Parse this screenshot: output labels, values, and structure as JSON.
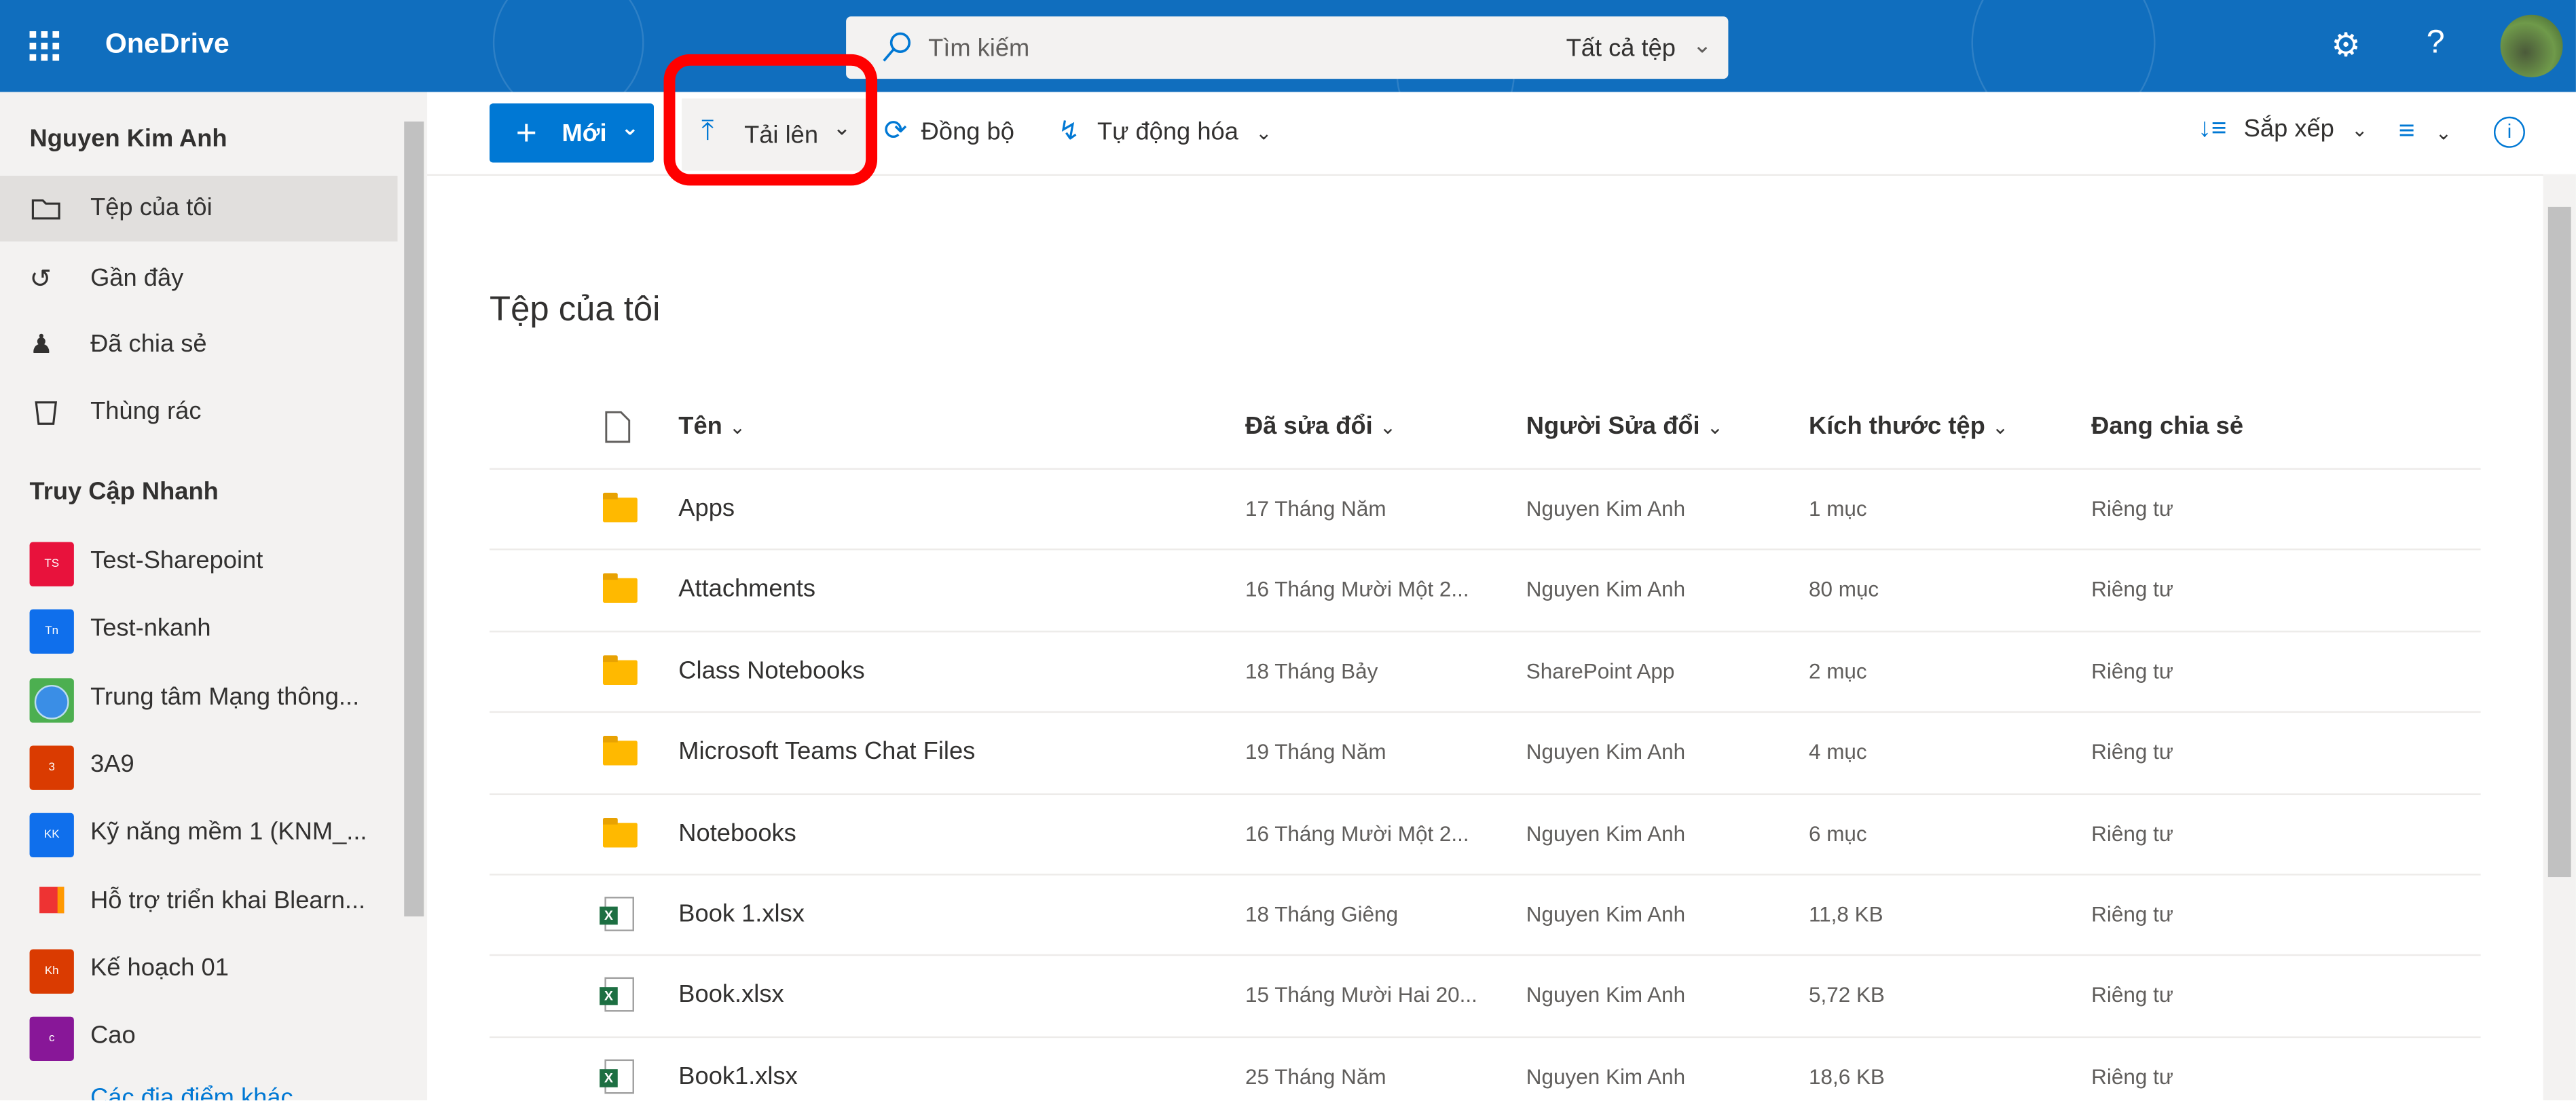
{
  "header": {
    "app_name": "OneDrive",
    "search_placeholder": "Tìm kiếm",
    "search_scope": "Tất cả tệp"
  },
  "sidebar": {
    "user": "Nguyen Kim Anh",
    "nav": [
      {
        "label": "Tệp của tôi",
        "icon": "folder-icon",
        "selected": true
      },
      {
        "label": "Gần đây",
        "icon": "history-icon"
      },
      {
        "label": "Đã chia sẻ",
        "icon": "people-icon"
      },
      {
        "label": "Thùng rác",
        "icon": "recycle-bin-icon"
      }
    ],
    "quick_access_title": "Truy Cập Nhanh",
    "quick_access": [
      {
        "label": "Test-Sharepoint",
        "initials": "TS",
        "color": "#e8123c"
      },
      {
        "label": "Test-nkanh",
        "initials": "Tn",
        "color": "#0f6fec"
      },
      {
        "label": "Trung tâm Mạng thông...",
        "initials": "",
        "color": "#4caf50"
      },
      {
        "label": "3A9",
        "initials": "3",
        "color": "#da3b01"
      },
      {
        "label": "Kỹ năng mềm 1 (KNM_...",
        "initials": "KK",
        "color": "#0f6fec"
      },
      {
        "label": "Hỗ trợ triển khai Blearn...",
        "initials": "",
        "color": "#f3f2f1"
      },
      {
        "label": "Kế hoạch 01",
        "initials": "Kh",
        "color": "#da3b01"
      },
      {
        "label": "Cao",
        "initials": "c",
        "color": "#881798"
      }
    ],
    "more_places": "Các địa điểm khác"
  },
  "toolbar": {
    "new": "Mới",
    "upload": "Tải lên",
    "sync": "Đồng bộ",
    "automate": "Tự động hóa",
    "sort": "Sắp xếp"
  },
  "main": {
    "title": "Tệp của tôi",
    "columns": [
      "Tên",
      "Đã sửa đổi",
      "Người Sửa đổi",
      "Kích thước tệp",
      "Đang chia sẻ"
    ],
    "rows": [
      {
        "type": "folder",
        "name": "Apps",
        "modified": "17 Tháng Năm",
        "modified_by": "Nguyen Kim Anh",
        "size": "1 mục",
        "sharing": "Riêng tư"
      },
      {
        "type": "folder",
        "name": "Attachments",
        "modified": "16 Tháng Mười Một 2...",
        "modified_by": "Nguyen Kim Anh",
        "size": "80 mục",
        "sharing": "Riêng tư"
      },
      {
        "type": "folder",
        "name": "Class Notebooks",
        "modified": "18 Tháng Bảy",
        "modified_by": "SharePoint App",
        "size": "2 mục",
        "sharing": "Riêng tư"
      },
      {
        "type": "folder",
        "name": "Microsoft Teams Chat Files",
        "modified": "19 Tháng Năm",
        "modified_by": "Nguyen Kim Anh",
        "size": "4 mục",
        "sharing": "Riêng tư"
      },
      {
        "type": "folder",
        "name": "Notebooks",
        "modified": "16 Tháng Mười Một 2...",
        "modified_by": "Nguyen Kim Anh",
        "size": "6 mục",
        "sharing": "Riêng tư"
      },
      {
        "type": "excel",
        "name": "Book 1.xlsx",
        "modified": "18 Tháng Giêng",
        "modified_by": "Nguyen Kim Anh",
        "size": "11,8 KB",
        "sharing": "Riêng tư"
      },
      {
        "type": "excel",
        "name": "Book.xlsx",
        "modified": "15 Tháng Mười Hai 20...",
        "modified_by": "Nguyen Kim Anh",
        "size": "5,72 KB",
        "sharing": "Riêng tư"
      },
      {
        "type": "excel",
        "name": "Book1.xlsx",
        "modified": "25 Tháng Năm",
        "modified_by": "Nguyen Kim Anh",
        "size": "18,6 KB",
        "sharing": "Riêng tư"
      }
    ]
  },
  "colors": {
    "header": "#106ebe",
    "accent": "#0078d4",
    "highlight": "#ff0000"
  }
}
